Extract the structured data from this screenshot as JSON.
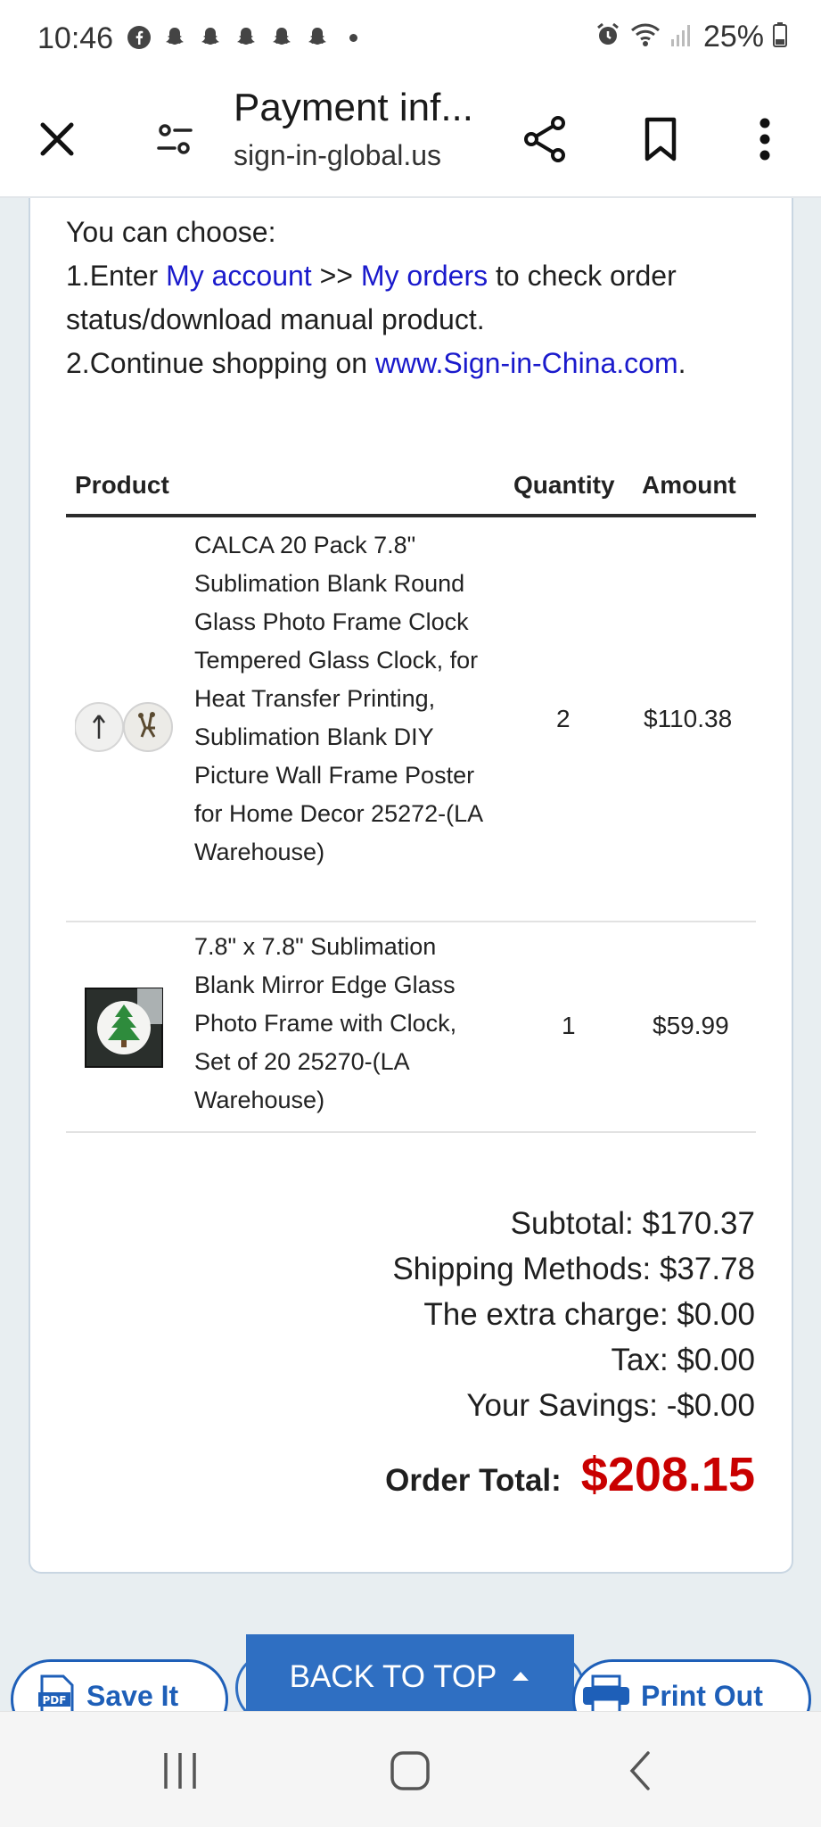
{
  "status_bar": {
    "time": "10:46",
    "battery": "25%",
    "icons": [
      "facebook-icon",
      "snapchat-icon",
      "snapchat-icon",
      "snapchat-icon",
      "snapchat-icon",
      "snapchat-icon",
      "alarm-icon",
      "wifi-icon",
      "signal-icon",
      "battery-icon"
    ]
  },
  "header": {
    "title": "Payment inf...",
    "url": "sign-in-global.us"
  },
  "intro": {
    "line1": "You can choose:",
    "step1_prefix": "1.Enter ",
    "my_account": "My account",
    "separator": " >> ",
    "my_orders": "My orders",
    "step1_suffix": " to check order status/download manual product.",
    "step2_prefix": "2.Continue shopping on ",
    "site_link": "www.Sign-in-China.com",
    "step2_suffix": "."
  },
  "table": {
    "headers": {
      "product": "Product",
      "quantity": "Quantity",
      "amount": "Amount"
    },
    "rows": [
      {
        "name": "CALCA 20 Pack 7.8\" Sublimation Blank Round Glass Photo Frame Clock Tempered Glass Clock, for Heat Transfer Printing, Sublimation Blank DIY Picture Wall Frame Poster for Home Decor 25272-(LA Warehouse)",
        "quantity": "2",
        "amount": "$110.38"
      },
      {
        "name": "7.8\" x 7.8\" Sublimation Blank Mirror Edge Glass Photo Frame with Clock, Set of 20 25270-(LA Warehouse)",
        "quantity": "1",
        "amount": "$59.99"
      }
    ]
  },
  "totals": {
    "subtotal": "Subtotal: $170.37",
    "shipping": "Shipping Methods: $37.78",
    "extra": "The extra charge: $0.00",
    "tax": "Tax: $0.00",
    "savings": "Your Savings: -$0.00",
    "order_total_label": "Order Total:",
    "order_total_value": "$208.15"
  },
  "buttons": {
    "save": "Save It",
    "back_to_top": "BACK TO TOP",
    "print": "Print Out"
  },
  "colors": {
    "link": "#1a1acc",
    "total_red": "#c90000",
    "accent_blue": "#2f6fc2"
  }
}
